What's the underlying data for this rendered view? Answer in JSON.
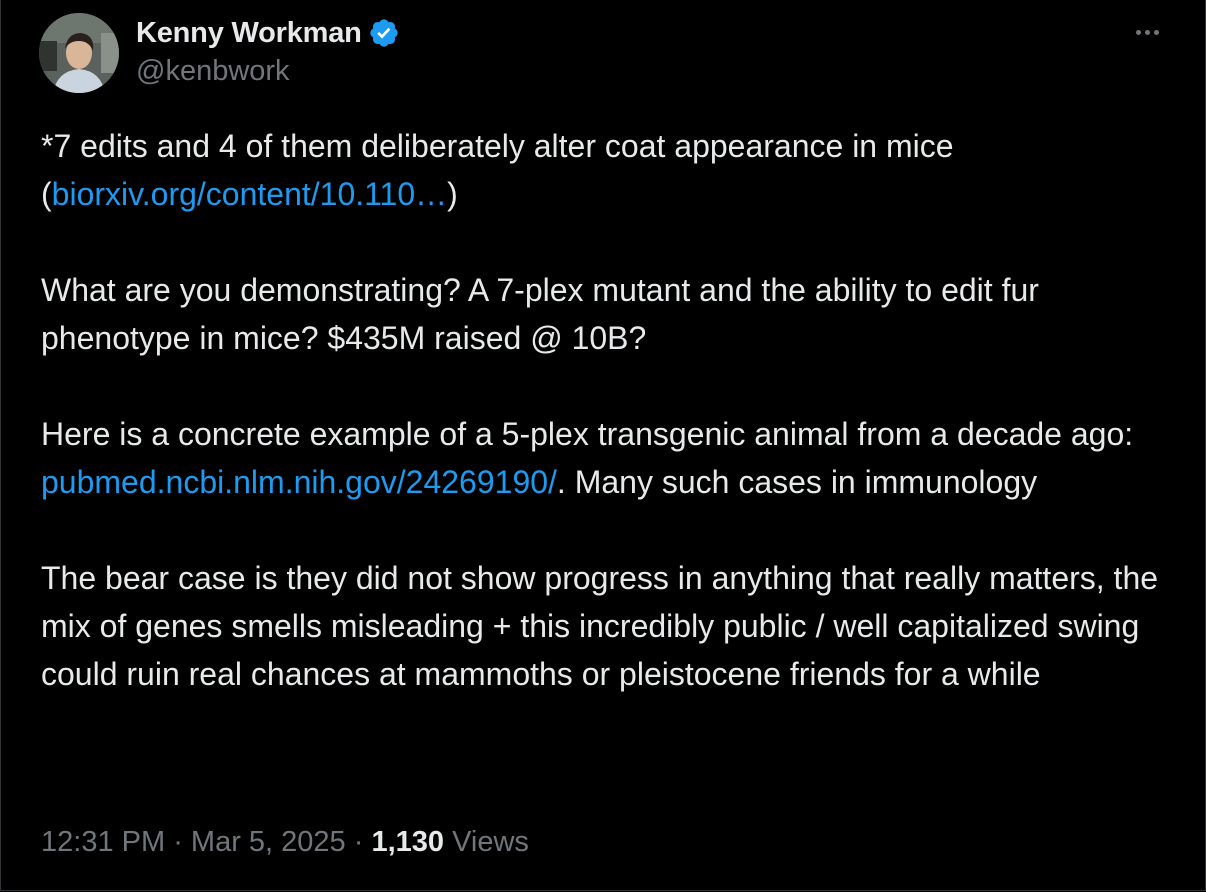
{
  "author": {
    "name": "Kenny Workman",
    "handle": "@kenbwork"
  },
  "tweet": {
    "p1": {
      "text": "*7 edits and 4 of them deliberately alter coat appearance in mice",
      "paren_open": "(",
      "link": "biorxiv.org/content/10.110…",
      "paren_close": ")"
    },
    "p2": {
      "text": "What are you demonstrating? A 7-plex mutant and the ability to edit fur phenotype in mice? $435M raised @ 10B?"
    },
    "p3": {
      "before": "Here is a concrete example of a 5-plex transgenic animal from a decade ago: ",
      "link": "pubmed.ncbi.nlm.nih.gov/24269190/",
      "after": ". Many such cases in immunology"
    },
    "p4": {
      "text": "The bear case is they did not show progress in anything that really matters, the mix of genes smells misleading + this incredibly public / well capitalized swing could ruin real chances at mammoths or pleistocene friends for a while"
    }
  },
  "meta": {
    "time": "12:31 PM",
    "separator": " · ",
    "date": "Mar 5, 2025",
    "views_count": "1,130",
    "views_label": " Views"
  },
  "colors": {
    "background": "#000000",
    "text": "#e7e9ea",
    "secondary": "#71767b",
    "link": "#1d9bf0",
    "verified": "#1d9bf0"
  },
  "icons": {
    "verified": "verified-badge-icon",
    "more": "more-options-icon"
  }
}
